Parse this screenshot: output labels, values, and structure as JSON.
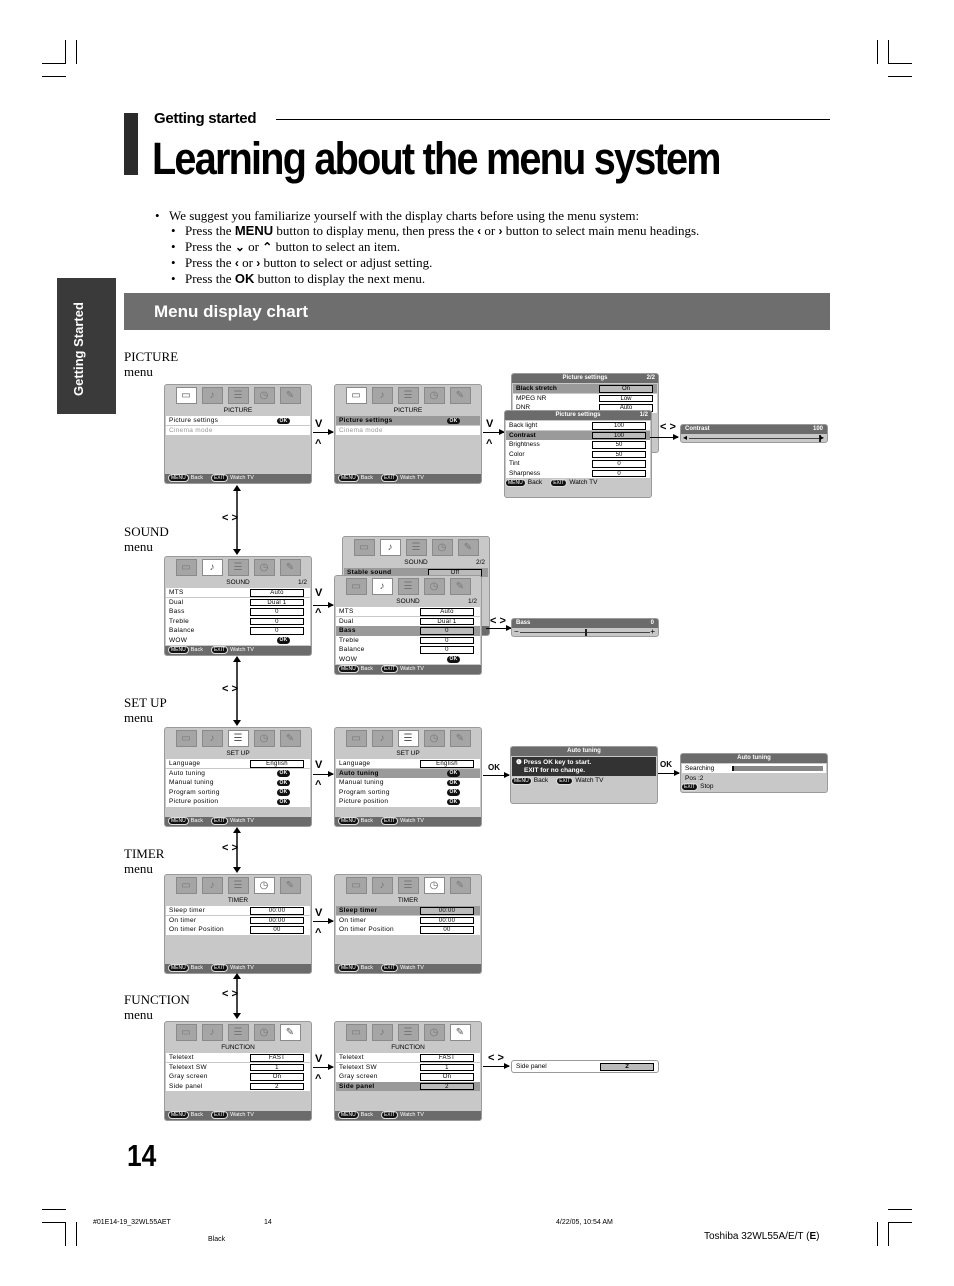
{
  "header": {
    "section": "Getting started",
    "title": "Learning about the menu system"
  },
  "intro": {
    "lead": "We suggest you familiarize yourself with the display charts before using the menu system:",
    "steps": [
      {
        "pre": "Press the ",
        "key": "MENU",
        "post": " button to display menu, then press the ",
        "g1": "‹",
        "mid": " or ",
        "g2": "›",
        "end": " button to select main menu headings."
      },
      {
        "pre": "Press the ",
        "g1": "⌄",
        "mid": " or ",
        "g2": "⌃",
        "end": " button to select an item."
      },
      {
        "pre": "Press the ",
        "g1": "‹",
        "mid": " or ",
        "g2": "›",
        "end": " button to select or adjust setting."
      },
      {
        "pre": "Press the ",
        "key": "OK",
        "end": " button to display the next menu."
      }
    ]
  },
  "side_tab": "Getting Started",
  "chart_header": "Menu display chart",
  "menu_word": "menu",
  "footer_btns": {
    "menu": "MENU",
    "back": "Back",
    "exit": "EXIT",
    "watch": "Watch TV",
    "stop": "Stop",
    "ok": "OK"
  },
  "icons": [
    "picture-icon",
    "sound-icon",
    "setup-icon",
    "timer-icon",
    "function-icon"
  ],
  "sections": {
    "picture": {
      "label": "PICTURE",
      "screen": {
        "name": "PICTURE",
        "rows": [
          {
            "label": "Picture settings",
            "ok": true
          },
          {
            "label": "Cinema mode",
            "dim": true
          }
        ]
      },
      "settings_p2": {
        "title": "Picture settings",
        "page": "2/2",
        "rows": [
          {
            "label": "Black stretch",
            "value": "On"
          },
          {
            "label": "MPEG NR",
            "value": "Low"
          },
          {
            "label": "DNR",
            "value": "Auto"
          }
        ]
      },
      "settings_p1": {
        "title": "Picture settings",
        "page": "1/2",
        "rows": [
          {
            "label": "Back light",
            "value": "100"
          },
          {
            "label": "Contrast",
            "value": "100"
          },
          {
            "label": "Brightness",
            "value": "50"
          },
          {
            "label": "Color",
            "value": "50"
          },
          {
            "label": "Tint",
            "value": "0"
          },
          {
            "label": "Sharpness",
            "value": "0"
          }
        ]
      },
      "slider": {
        "label": "Contrast",
        "value": "100",
        "level": 1.0
      }
    },
    "sound": {
      "label": "SOUND",
      "screen": {
        "name": "SOUND",
        "page": "1/2",
        "rows": [
          {
            "label": "MTS",
            "value": "Auto"
          },
          {
            "label": "Dual",
            "value": "Dual 1"
          },
          {
            "label": "Bass",
            "value": "0"
          },
          {
            "label": "Treble",
            "value": "0"
          },
          {
            "label": "Balance",
            "value": "0"
          },
          {
            "label": "WOW",
            "ok": true
          }
        ]
      },
      "page2": {
        "name": "SOUND",
        "page": "2/2",
        "rows": [
          {
            "label": "Stable sound",
            "value": "Off"
          }
        ]
      },
      "slider": {
        "label": "Bass",
        "value": "0",
        "level": 0.5,
        "minus": "−",
        "plus": "+"
      }
    },
    "setup": {
      "label": "SET UP",
      "screen": {
        "name": "SET UP",
        "rows": [
          {
            "label": "Language",
            "value": "English"
          },
          {
            "label": "Auto tuning",
            "ok": true
          },
          {
            "label": "Manual tuning",
            "ok": true
          },
          {
            "label": "Program sorting",
            "ok": true
          },
          {
            "label": "Picture position",
            "ok": true
          }
        ]
      },
      "autotune": {
        "title": "Auto tuning",
        "line1": "Press OK key to start.",
        "line2": "EXIT for no change."
      },
      "autotune2": {
        "title": "Auto tuning",
        "searching": "Searching",
        "pos": "Pos    :2",
        "progress": 0.02
      }
    },
    "timer": {
      "label": "TIMER",
      "screen": {
        "name": "TIMER",
        "rows": [
          {
            "label": "Sleep timer",
            "value": "00:00"
          },
          {
            "label": "On timer",
            "value": "00:00"
          },
          {
            "label": "On timer Position",
            "value": "00"
          }
        ]
      }
    },
    "function": {
      "label": "FUNCTION",
      "screen": {
        "name": "FUNCTION",
        "rows": [
          {
            "label": "Teletext",
            "value": "FAST"
          },
          {
            "label": "Teletext SW",
            "value": "1"
          },
          {
            "label": "Gray screen",
            "value": "On"
          },
          {
            "label": "Side panel",
            "value": "2"
          }
        ]
      },
      "sidepanel": {
        "label": "Side panel",
        "value": "2"
      }
    }
  },
  "glyphs": {
    "down": "⌄",
    "up": "⌃",
    "lr": "< >",
    "ok": "OK"
  },
  "page_number": "14",
  "print_footer": {
    "file": "#01E14-19_32WL55AET",
    "page": "14",
    "datetime": "4/22/05, 10:54 AM",
    "color": "Black"
  },
  "model": {
    "text": "Toshiba 32WL55A/E/T (",
    "bold": "E",
    "close": ")"
  }
}
